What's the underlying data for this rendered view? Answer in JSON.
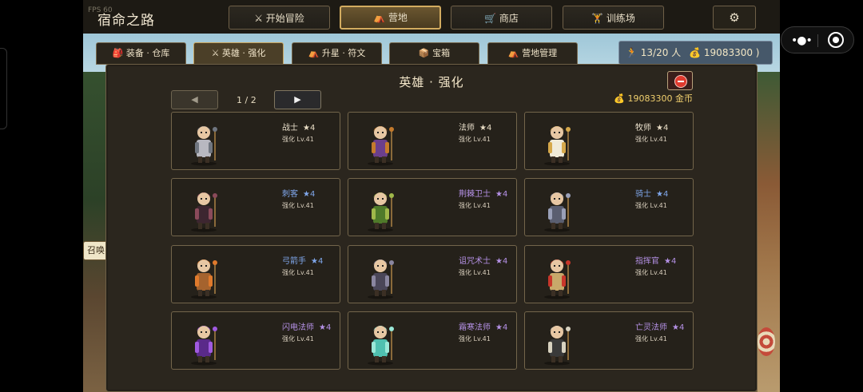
{
  "app": {
    "title": "宿命之路",
    "fps": "FPS 60"
  },
  "top_nav": [
    {
      "icon": "crossed-swords-icon",
      "label": "⚔ 开始冒险",
      "active": false
    },
    {
      "icon": "camp-icon",
      "label": "⛺ 营地",
      "active": true
    },
    {
      "icon": "cart-icon",
      "label": "🛒 商店",
      "active": false
    },
    {
      "icon": "dumbbell-icon",
      "label": "🏋 训练场",
      "active": false
    }
  ],
  "settings": {
    "icon": "gear-icon",
    "glyph": "⚙"
  },
  "sub_tabs": [
    {
      "label": "🎒 装备 · 仓库",
      "active": false
    },
    {
      "label": "⚔ 英雄 · 强化",
      "active": true
    },
    {
      "label": "⛺ 升星 · 符文",
      "active": false
    },
    {
      "label": "📦 宝箱",
      "active": false
    },
    {
      "label": "⛺ 营地管理",
      "active": false
    }
  ],
  "status": {
    "population": "🏃 13/20 人",
    "gold": "💰 19083300 )"
  },
  "scene": {
    "summon_tag": "召唤"
  },
  "panel": {
    "title": "英雄 · 强化",
    "page_prev": "◀",
    "page_next": "▶",
    "page_label": "1 / 2",
    "gold": "💰 19083300 金币"
  },
  "heroes": [
    {
      "name": "战士",
      "stars": "★4",
      "level": "强化 Lv.41",
      "name_color": "#eae0cc",
      "star_color": "#e8dcc4",
      "robe": "#b8b8c0",
      "trim": "#707680"
    },
    {
      "name": "法师",
      "stars": "★4",
      "level": "强化 Lv.41",
      "name_color": "#eae0cc",
      "star_color": "#e8dcc4",
      "robe": "#6b3f8c",
      "trim": "#c47a2c"
    },
    {
      "name": "牧师",
      "stars": "★4",
      "level": "强化 Lv.41",
      "name_color": "#eae0cc",
      "star_color": "#e8dcc4",
      "robe": "#f0ead8",
      "trim": "#d6a84a"
    },
    {
      "name": "刺客",
      "stars": "★4",
      "level": "强化 Lv.41",
      "name_color": "#7fa6ea",
      "star_color": "#7fa6ea",
      "robe": "#3d2630",
      "trim": "#8a4a5a"
    },
    {
      "name": "荆棘卫士",
      "stars": "★4",
      "level": "强化 Lv.41",
      "name_color": "#b591e6",
      "star_color": "#b591e6",
      "robe": "#4f7a2a",
      "trim": "#a0b84a"
    },
    {
      "name": "骑士",
      "stars": "★4",
      "level": "强化 Lv.41",
      "name_color": "#7fa6ea",
      "star_color": "#7fa6ea",
      "robe": "#5a5e70",
      "trim": "#9aa0b8"
    },
    {
      "name": "弓箭手",
      "stars": "★4",
      "level": "强化 Lv.41",
      "name_color": "#7fa6ea",
      "star_color": "#7fa6ea",
      "robe": "#a5632e",
      "trim": "#e07a2c"
    },
    {
      "name": "诅咒术士",
      "stars": "★4",
      "level": "强化 Lv.41",
      "name_color": "#b591e6",
      "star_color": "#b591e6",
      "robe": "#4a4658",
      "trim": "#8a86a0"
    },
    {
      "name": "指挥官",
      "stars": "★4",
      "level": "强化 Lv.41",
      "name_color": "#b591e6",
      "star_color": "#b591e6",
      "robe": "#c8a96a",
      "trim": "#c8362a"
    },
    {
      "name": "闪电法师",
      "stars": "★4",
      "level": "强化 Lv.41",
      "name_color": "#b591e6",
      "star_color": "#b591e6",
      "robe": "#5a2a8a",
      "trim": "#a05ae0"
    },
    {
      "name": "霜寒法师",
      "stars": "★4",
      "level": "强化 Lv.41",
      "name_color": "#b591e6",
      "star_color": "#b591e6",
      "robe": "#4fc0b0",
      "trim": "#9ae8d8"
    },
    {
      "name": "亡灵法师",
      "stars": "★4",
      "level": "强化 Lv.41",
      "name_color": "#b591e6",
      "star_color": "#b591e6",
      "robe": "#3a3a3a",
      "trim": "#d8d2c0"
    }
  ],
  "mini_program": {
    "menu_icon": "more-dots-icon",
    "close_icon": "target-close-icon",
    "menu_glyph": "•●•"
  }
}
